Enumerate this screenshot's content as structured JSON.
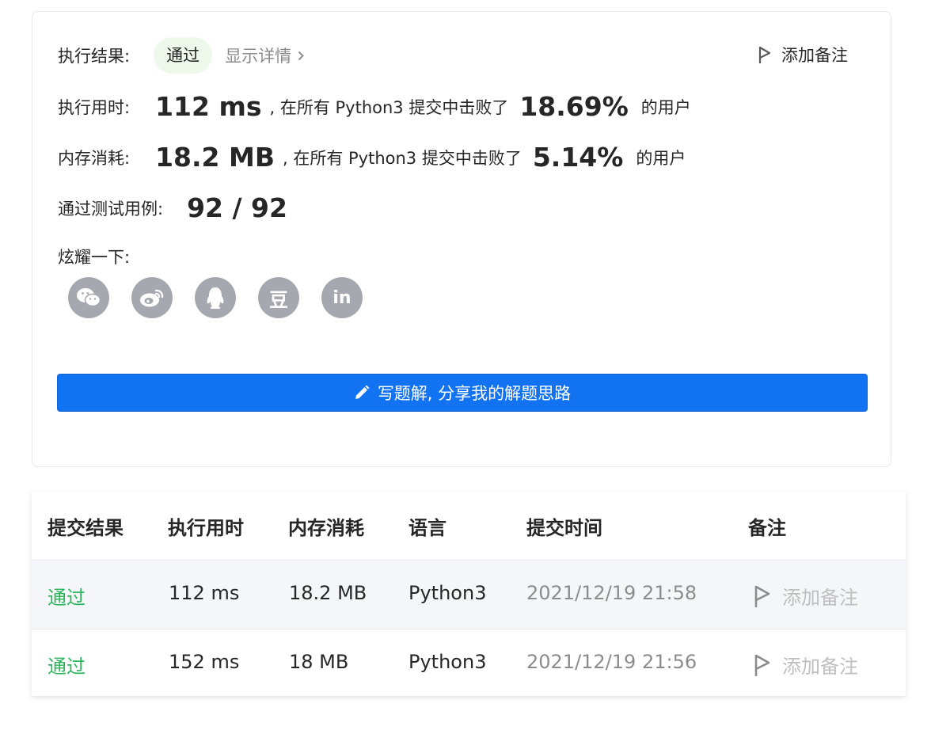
{
  "result": {
    "label": "执行结果:",
    "status": "通过",
    "details_link": "显示详情",
    "add_note": "添加备注"
  },
  "runtime": {
    "label": "执行用时:",
    "value": "112 ms",
    "prefix": ", 在所有 Python3 提交中击败了",
    "percent": "18.69%",
    "suffix": "的用户"
  },
  "memory": {
    "label": "内存消耗:",
    "value": "18.2 MB",
    "prefix": ", 在所有 Python3 提交中击败了",
    "percent": "5.14%",
    "suffix": "的用户"
  },
  "testcases": {
    "label": "通过测试用例:",
    "value": "92 / 92"
  },
  "share": {
    "label": "炫耀一下:",
    "icons": [
      "wechat-icon",
      "weibo-icon",
      "qq-icon",
      "douban-icon",
      "linkedin-icon"
    ],
    "douban_glyph": "豆",
    "linkedin_glyph": "in"
  },
  "write_button": "写题解, 分享我的解题思路",
  "table": {
    "headers": [
      "提交结果",
      "执行用时",
      "内存消耗",
      "语言",
      "提交时间",
      "备注"
    ],
    "rows": [
      {
        "result": "通过",
        "runtime": "112 ms",
        "memory": "18.2 MB",
        "language": "Python3",
        "time": "2021/12/19 21:58",
        "note": "添加备注"
      },
      {
        "result": "通过",
        "runtime": "152 ms",
        "memory": "18 MB",
        "language": "Python3",
        "time": "2021/12/19 21:56",
        "note": "添加备注"
      }
    ]
  },
  "colors": {
    "accent": "#1273f2",
    "pass_green": "#2db55d",
    "pill_bg": "#eef9ec",
    "icon_gray": "#a5a8ae"
  }
}
